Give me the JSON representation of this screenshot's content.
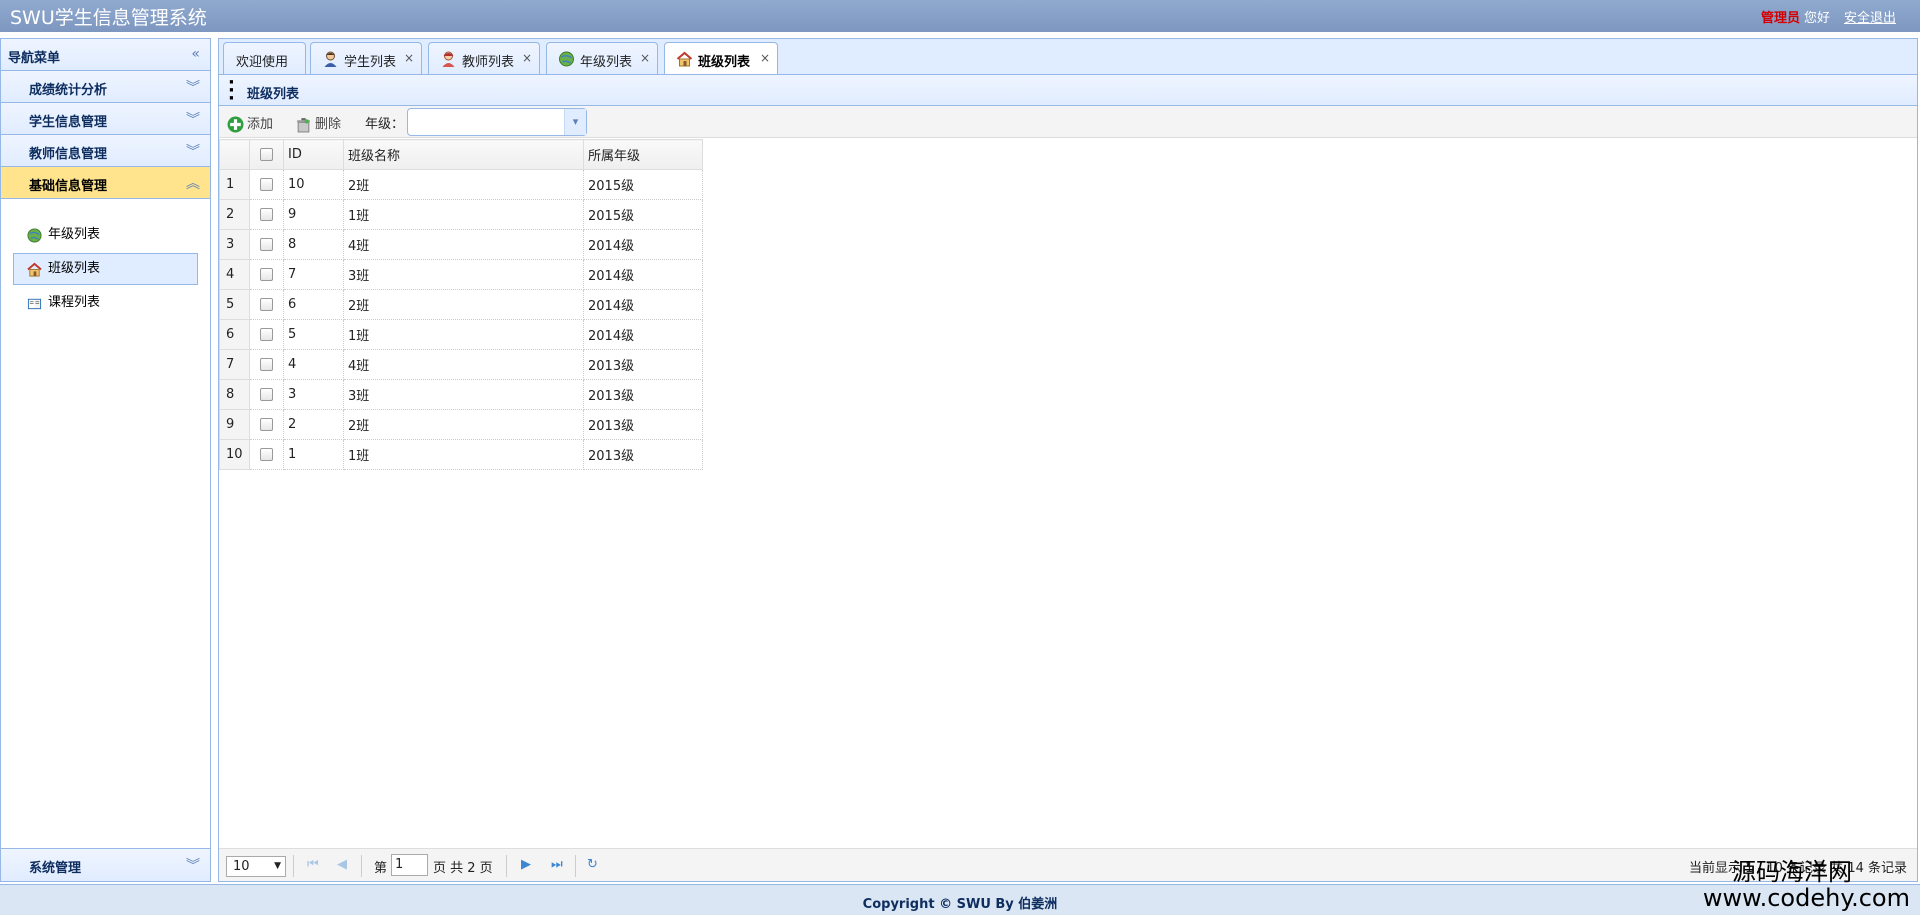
{
  "app": {
    "title": "SWU学生信息管理系统"
  },
  "header": {
    "role": "管理员",
    "greeting": "您好",
    "logout": "安全退出"
  },
  "sidebar": {
    "title": "导航菜单",
    "sections": [
      {
        "label": "成绩统计分析",
        "expanded": false
      },
      {
        "label": "学生信息管理",
        "expanded": false
      },
      {
        "label": "教师信息管理",
        "expanded": false
      },
      {
        "label": "基础信息管理",
        "expanded": true
      }
    ],
    "items": [
      {
        "label": "年级列表",
        "icon": "globe-icon",
        "selected": false
      },
      {
        "label": "班级列表",
        "icon": "house-icon",
        "selected": true
      },
      {
        "label": "课程列表",
        "icon": "book-icon",
        "selected": false
      }
    ],
    "bottom": {
      "label": "系统管理"
    }
  },
  "tabs": [
    {
      "label": "欢迎使用",
      "icon": "",
      "closable": false,
      "active": false
    },
    {
      "label": "学生列表",
      "icon": "student-icon",
      "closable": true,
      "active": false
    },
    {
      "label": "教师列表",
      "icon": "teacher-icon",
      "closable": true,
      "active": false
    },
    {
      "label": "年级列表",
      "icon": "globe-icon",
      "closable": true,
      "active": false
    },
    {
      "label": "班级列表",
      "icon": "house-icon",
      "closable": true,
      "active": true
    }
  ],
  "panel": {
    "title": "班级列表"
  },
  "toolbar": {
    "add": "添加",
    "delete": "删除",
    "grade_label": "年级：",
    "grade_value": ""
  },
  "table": {
    "columns": [
      "ID",
      "班级名称",
      "所属年级"
    ],
    "rows": [
      [
        "1",
        "10",
        "2班",
        "2015级"
      ],
      [
        "2",
        "9",
        "1班",
        "2015级"
      ],
      [
        "3",
        "8",
        "4班",
        "2014级"
      ],
      [
        "4",
        "7",
        "3班",
        "2014级"
      ],
      [
        "5",
        "6",
        "2班",
        "2014级"
      ],
      [
        "6",
        "5",
        "1班",
        "2014级"
      ],
      [
        "7",
        "4",
        "4班",
        "2013级"
      ],
      [
        "8",
        "3",
        "3班",
        "2013级"
      ],
      [
        "9",
        "2",
        "2班",
        "2013级"
      ],
      [
        "10",
        "1",
        "1班",
        "2013级"
      ]
    ]
  },
  "pager": {
    "page_size": "10",
    "page_prefix": "第",
    "current_page": "1",
    "page_suffix": "页 共 2 页",
    "info": "当前显示 1 - 10 条记录 共 14 条记录"
  },
  "footer": {
    "copyright": "Copyright © SWU By 伯姜洲"
  },
  "watermark": {
    "line1": "源码海洋网",
    "line2": "www.codehy.com"
  },
  "colors": {
    "header": "#7d97c0",
    "border": "#95b8e7",
    "active_section": "#ffe48d",
    "role": "#d40000"
  }
}
